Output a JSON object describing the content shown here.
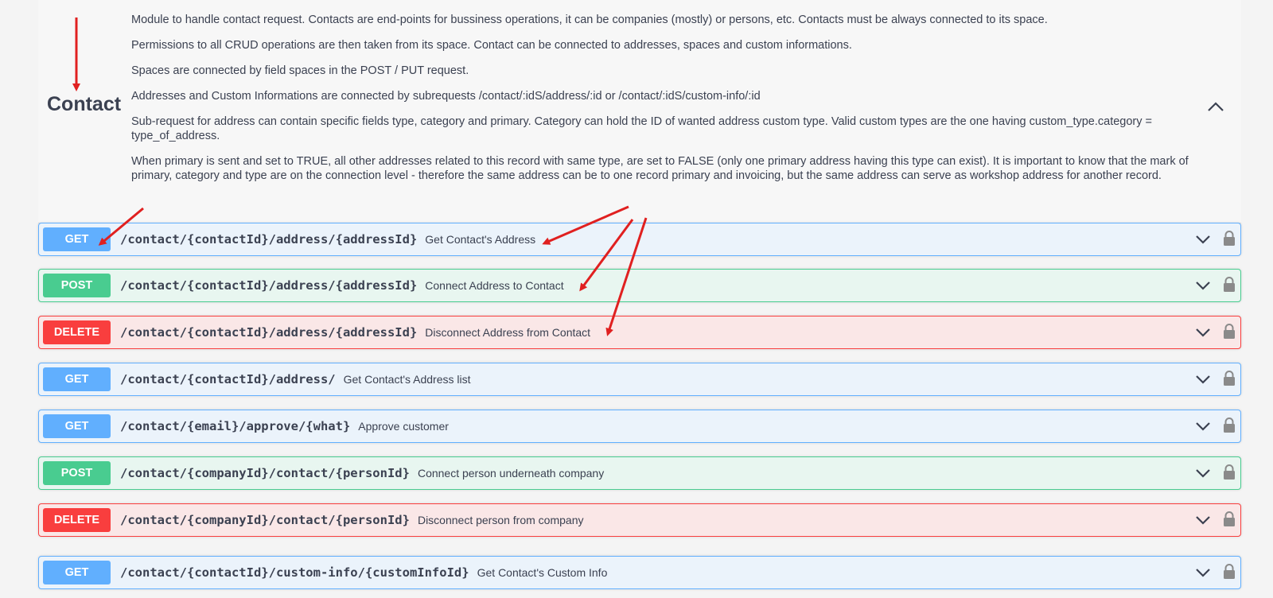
{
  "tag": {
    "title": "Contact",
    "description": [
      "Module to handle contact request. Contacts are end-points for bussiness operations, it can be companies (mostly) or persons, etc. Contacts must be always connected to its space.",
      "Permissions to all CRUD operations are then taken from its space. Contact can be connected to addresses, spaces and custom informations.",
      "Spaces are connected by field spaces in the POST / PUT request.",
      "Addresses and Custom Informations are connected by subrequests /contact/:idS/address/:id or /contact/:idS/custom-info/:id",
      "Sub-request for address can contain specific fields type, category and primary. Category can hold the ID of wanted address custom type. Valid custom types are the one having custom_type.category = type_of_address.",
      "When primary is sent and set to TRUE, all other addresses related to this record with same type, are set to FALSE (only one primary address having this type can exist). It is important to know that the mark of primary, category and type are on the connection level - therefore the same address can be to one record primary and invoicing, but the same address can serve as workshop address for another record."
    ],
    "collapse_icon": "chevron-up-icon"
  },
  "operations": [
    {
      "method": "GET",
      "path": "/contact/{contactId}/address/{addressId}",
      "summary": "Get Contact's Address"
    },
    {
      "method": "POST",
      "path": "/contact/{contactId}/address/{addressId}",
      "summary": "Connect Address to Contact"
    },
    {
      "method": "DELETE",
      "path": "/contact/{contactId}/address/{addressId}",
      "summary": "Disconnect Address from Contact"
    },
    {
      "method": "GET",
      "path": "/contact/{contactId}/address/",
      "summary": "Get Contact's Address list"
    },
    {
      "method": "GET",
      "path": "/contact/{email}/approve/{what}",
      "summary": "Approve customer"
    },
    {
      "method": "POST",
      "path": "/contact/{companyId}/contact/{personId}",
      "summary": "Connect person underneath company"
    },
    {
      "method": "DELETE",
      "path": "/contact/{companyId}/contact/{personId}",
      "summary": "Disconnect person from company"
    },
    {
      "method": "GET",
      "path": "/contact/{contactId}/custom-info/{customInfoId}",
      "summary": "Get Contact's Custom Info"
    }
  ],
  "icons": {
    "expand": "chevron-down-icon",
    "auth": "lock-icon"
  },
  "colors": {
    "get": "#61affe",
    "post": "#49cc90",
    "delete": "#f93e3e",
    "annotation_arrow": "#e02020"
  }
}
